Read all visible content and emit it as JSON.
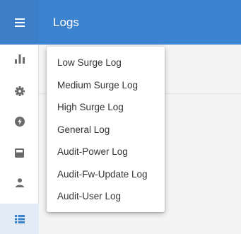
{
  "header": {
    "title": "Logs"
  },
  "colors": {
    "header_bg": "#3b83cf",
    "menu_btn_bg": "#3d7ec9",
    "rail_icon": "#6b6b6b",
    "active_icon": "#3b83cf",
    "active_bg": "#e2ebf6"
  },
  "rail": {
    "items": [
      {
        "icon": "hamburger-menu-icon"
      },
      {
        "icon": "bar-chart-icon"
      },
      {
        "icon": "gear-icon"
      },
      {
        "icon": "power-bolt-icon"
      },
      {
        "icon": "device-icon"
      },
      {
        "icon": "user-icon"
      },
      {
        "icon": "list-icon",
        "active": true
      }
    ]
  },
  "dropdown": {
    "items": [
      {
        "label": "Low Surge Log"
      },
      {
        "label": "Medium Surge Log"
      },
      {
        "label": "High Surge Log"
      },
      {
        "label": "General Log"
      },
      {
        "label": "Audit-Power Log"
      },
      {
        "label": "Audit-Fw-Update Log"
      },
      {
        "label": "Audit-User Log"
      }
    ]
  }
}
